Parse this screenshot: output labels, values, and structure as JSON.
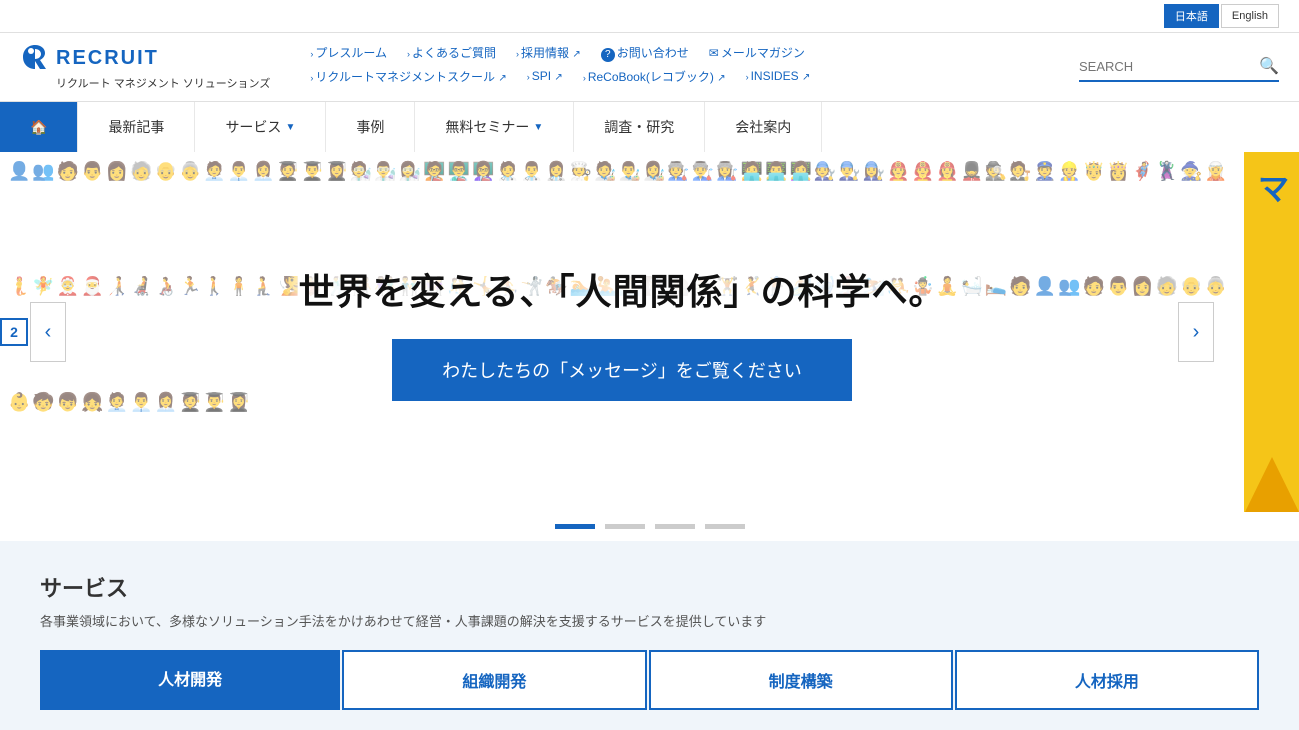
{
  "lang": {
    "japanese": "日本語",
    "english": "English"
  },
  "top_nav": {
    "row1": [
      {
        "id": "press",
        "label": "プレスルーム"
      },
      {
        "id": "faq",
        "label": "よくあるご質問"
      },
      {
        "id": "recruit",
        "label": "採用情報",
        "ext": true
      },
      {
        "id": "contact",
        "label": "お問い合わせ",
        "icon": "?"
      },
      {
        "id": "mail",
        "label": "メールマガジン"
      }
    ],
    "row2": [
      {
        "id": "school",
        "label": "リクルートマネジメントスクール",
        "ext": true
      },
      {
        "id": "spi",
        "label": "SPI",
        "ext": true
      },
      {
        "id": "recobook",
        "label": "ReCoBook(レコブック)",
        "ext": true
      },
      {
        "id": "insides",
        "label": "INSIDES",
        "ext": true
      }
    ]
  },
  "search": {
    "placeholder": "SEARCH"
  },
  "logo": {
    "letter": "R",
    "brand": "RECRUIT",
    "subtitle": "リクルート マネジメント ソリューションズ"
  },
  "main_nav": [
    {
      "id": "home",
      "label": "🏠",
      "icon": true
    },
    {
      "id": "news",
      "label": "最新記事"
    },
    {
      "id": "services",
      "label": "サービス",
      "arrow": true
    },
    {
      "id": "cases",
      "label": "事例"
    },
    {
      "id": "seminar",
      "label": "無料セミナー",
      "arrow": true
    },
    {
      "id": "research",
      "label": "調査・研究"
    },
    {
      "id": "company",
      "label": "会社案内"
    }
  ],
  "hero": {
    "slide_number": "2",
    "title": "世界を変える、「人間関係」の科学へ。",
    "button_label": "わたしたちの「メッセージ」をご覧ください",
    "prev_arrow": "‹",
    "next_arrow": "›",
    "side_label": "マ",
    "indicators": [
      {
        "active": true
      },
      {
        "active": false
      },
      {
        "active": false
      },
      {
        "active": false
      }
    ]
  },
  "services": {
    "title": "サービス",
    "description": "各事業領域において、多様なソリューション手法をかけあわせて経営・人事課題の解決を支援するサービスを提供しています",
    "cards": [
      {
        "id": "hr-dev",
        "label": "人材開発",
        "outline": false
      },
      {
        "id": "org-dev",
        "label": "組織開発",
        "outline": true
      },
      {
        "id": "system",
        "label": "制度構築",
        "outline": true
      },
      {
        "id": "hiring",
        "label": "人材採用",
        "outline": true
      }
    ]
  }
}
